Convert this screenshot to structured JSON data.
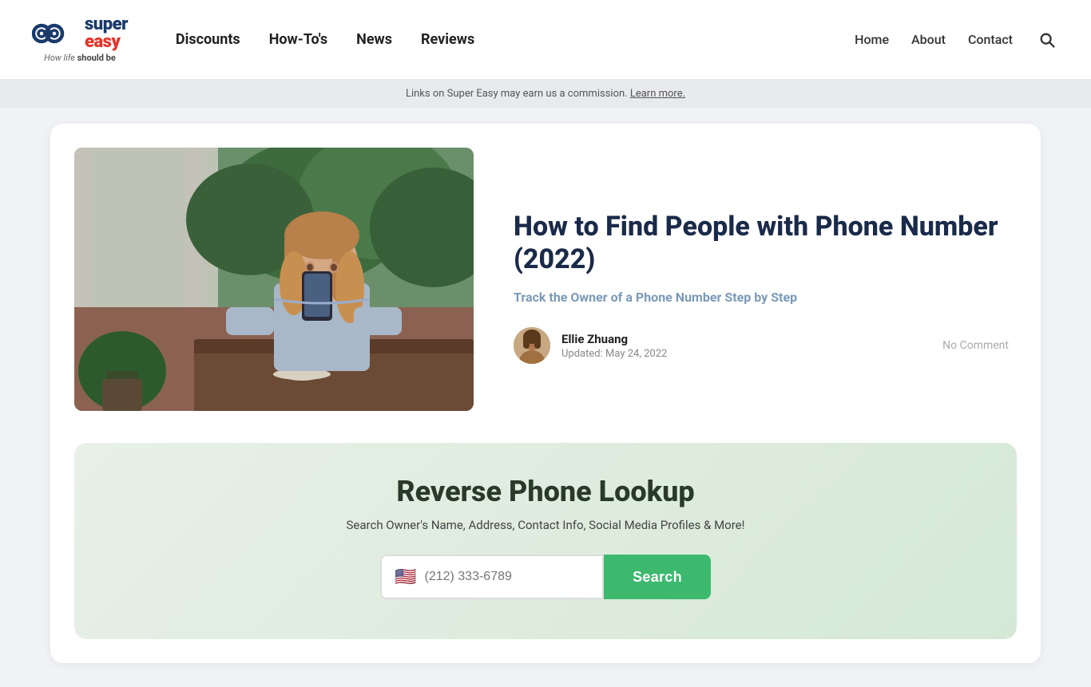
{
  "header": {
    "logo": {
      "super": "super",
      "easy": "easy",
      "tagline_normal": "How life ",
      "tagline_bold": "should be"
    },
    "nav": {
      "discounts": "Discounts",
      "howtos": "How-To's",
      "news": "News",
      "reviews": "Reviews"
    },
    "right_nav": {
      "home": "Home",
      "about": "About",
      "contact": "Contact"
    }
  },
  "commission_bar": {
    "text": "Links on Super Easy may earn us a commission.",
    "link_text": "Learn more."
  },
  "article": {
    "title": "How to Find People with Phone Number (2022)",
    "subtitle": "Track the Owner of a Phone Number Step by Step",
    "author": {
      "name": "Ellie Zhuang",
      "updated_label": "Updated:",
      "updated_date": "May 24, 2022"
    },
    "no_comment": "No Comment"
  },
  "widget": {
    "title": "Reverse Phone Lookup",
    "description": "Search Owner's Name, Address, Contact Info, Social Media Profiles & More!",
    "input_placeholder": "(212) 333-6789",
    "search_button": "Search",
    "flag": "🇺🇸"
  }
}
